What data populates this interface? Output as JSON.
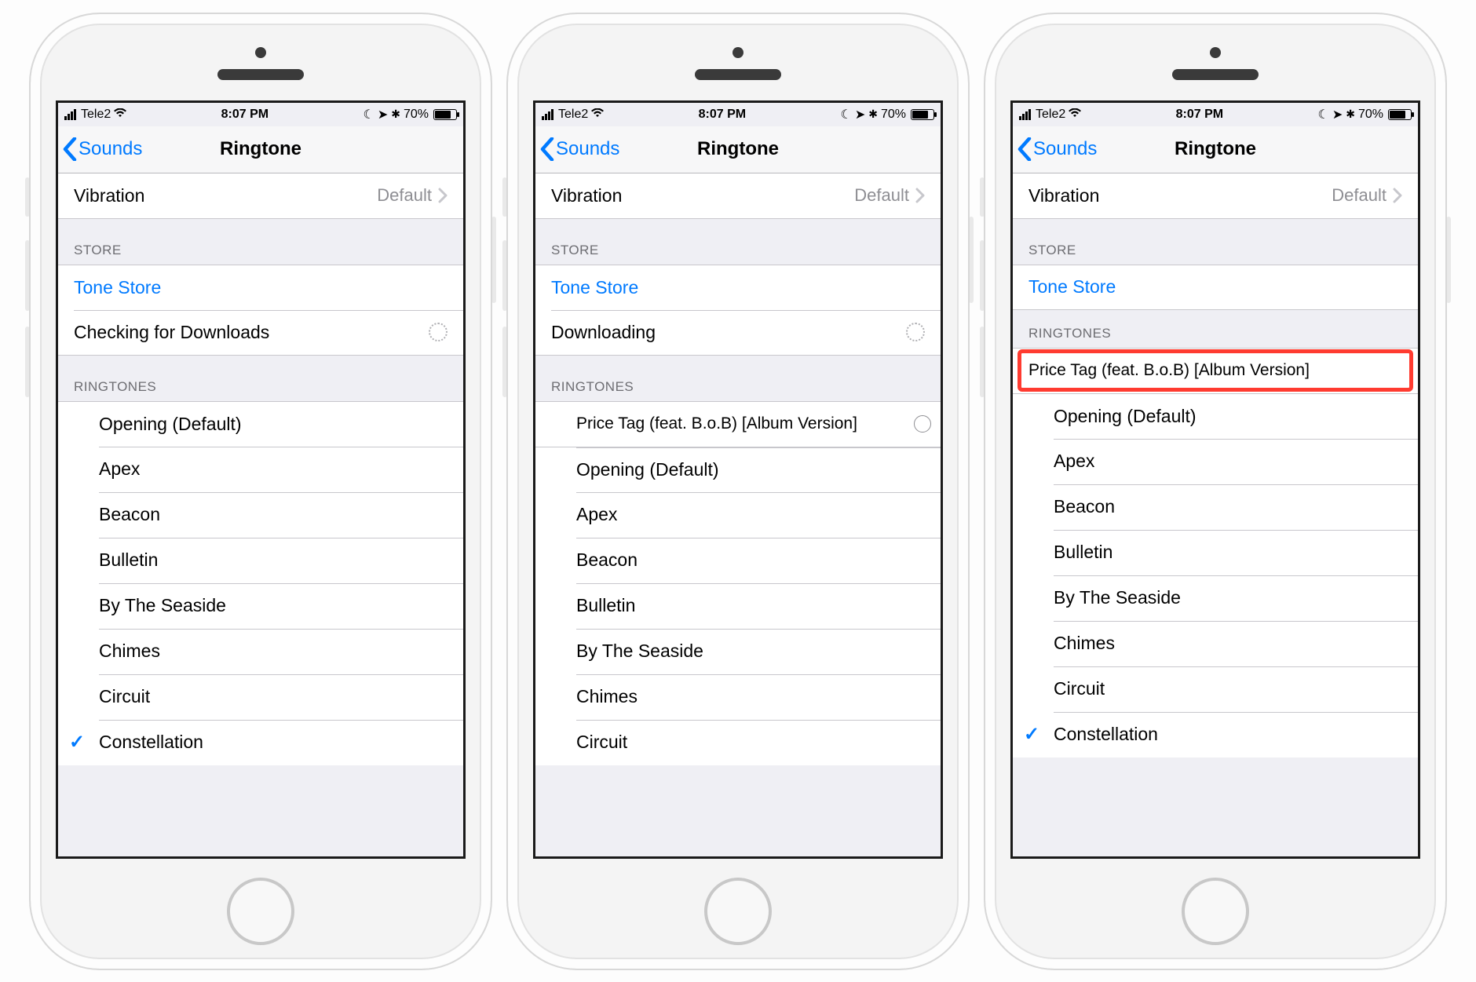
{
  "status": {
    "carrier": "Tele2",
    "time": "8:07 PM",
    "battery_percent": "70%"
  },
  "nav": {
    "back_label": "Sounds",
    "title": "Ringtone"
  },
  "rows": {
    "vibration_label": "Vibration",
    "vibration_value": "Default",
    "store_header": "STORE",
    "tone_store": "Tone Store",
    "checking_downloads": "Checking for Downloads",
    "downloading": "Downloading",
    "ringtones_header": "RINGTONES",
    "price_tag": "Price Tag (feat. B.o.B) [Album Version]"
  },
  "ringtones": {
    "opening": "Opening (Default)",
    "apex": "Apex",
    "beacon": "Beacon",
    "bulletin": "Bulletin",
    "by_the_seaside": "By The Seaside",
    "chimes": "Chimes",
    "circuit": "Circuit",
    "constellation": "Constellation"
  }
}
